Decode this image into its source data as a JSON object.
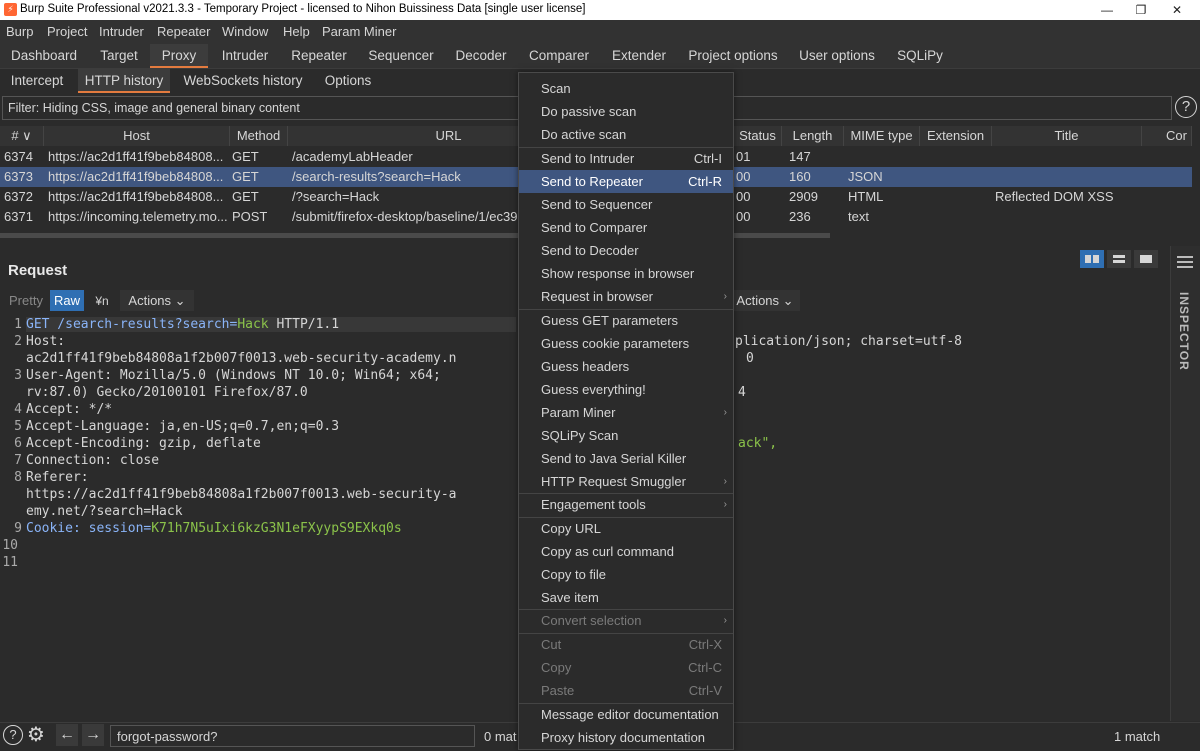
{
  "window": {
    "title": "Burp Suite Professional v2021.3.3 - Temporary Project - licensed to Nihon Buissiness Data [single user license]",
    "min": "—",
    "restore": "❐",
    "close": "✕"
  },
  "menubar": [
    "Burp",
    "Project",
    "Intruder",
    "Repeater",
    "Window",
    "Help",
    "Param Miner"
  ],
  "tool_tabs": [
    "Dashboard",
    "Target",
    "Proxy",
    "Intruder",
    "Repeater",
    "Sequencer",
    "Decoder",
    "Comparer",
    "Extender",
    "Project options",
    "User options",
    "SQLiPy"
  ],
  "active_tool_tab": "Proxy",
  "sub_tabs": [
    "Intercept",
    "HTTP history",
    "WebSockets history",
    "Options"
  ],
  "active_sub_tab": "HTTP history",
  "filter": "Filter: Hiding CSS, image and general binary content",
  "help": "?",
  "table": {
    "headers": [
      "# ∨",
      "Host",
      "Method",
      "URL",
      "Status",
      "Length",
      "MIME type",
      "Extension",
      "Title",
      "Cor"
    ],
    "rows": [
      {
        "id": "6374",
        "host": "https://ac2d1ff41f9beb84808...",
        "method": "GET",
        "url": "/academyLabHeader",
        "status": "01",
        "length": "147",
        "mime": "",
        "ext": "",
        "title": ""
      },
      {
        "id": "6373",
        "host": "https://ac2d1ff41f9beb84808...",
        "method": "GET",
        "url": "/search-results?search=Hack",
        "status": "00",
        "length": "160",
        "mime": "JSON",
        "ext": "",
        "title": ""
      },
      {
        "id": "6372",
        "host": "https://ac2d1ff41f9beb84808...",
        "method": "GET",
        "url": "/?search=Hack",
        "status": "00",
        "length": "2909",
        "mime": "HTML",
        "ext": "",
        "title": "Reflected DOM XSS"
      },
      {
        "id": "6371",
        "host": "https://incoming.telemetry.mo...",
        "method": "POST",
        "url": "/submit/firefox-desktop/baseline/1/ec39",
        "status": "00",
        "length": "236",
        "mime": "text",
        "ext": "",
        "title": ""
      }
    ],
    "selected_index": 1
  },
  "request": {
    "title": "Request",
    "tabs": [
      "Pretty",
      "Raw",
      "\\n",
      "Actions"
    ],
    "active_tab": "Raw",
    "lines": [
      {
        "n": "1",
        "text": "GET /search-results?search=Hack HTTP/1.1"
      },
      {
        "n": "2",
        "text": "Host:"
      },
      {
        "n": "",
        "text": "ac2d1ff41f9beb84808a1f2b007f0013.web-security-academy.n"
      },
      {
        "n": "3",
        "text": "User-Agent: Mozilla/5.0 (Windows NT 10.0; Win64; x64;"
      },
      {
        "n": "",
        "text": "rv:87.0) Gecko/20100101 Firefox/87.0"
      },
      {
        "n": "4",
        "text": "Accept: */*"
      },
      {
        "n": "5",
        "text": "Accept-Language: ja,en-US;q=0.7,en;q=0.3"
      },
      {
        "n": "6",
        "text": "Accept-Encoding: gzip, deflate"
      },
      {
        "n": "7",
        "text": "Connection: close"
      },
      {
        "n": "8",
        "text": "Referer:"
      },
      {
        "n": "",
        "text": "https://ac2d1ff41f9beb84808a1f2b007f0013.web-security-a"
      },
      {
        "n": "",
        "text": "emy.net/?search=Hack"
      },
      {
        "n": "9",
        "text": "Cookie: session=K71h7N5uIxi6kzG3N1eFXyypS9EXkq0s"
      },
      {
        "n": "10",
        "text": ""
      },
      {
        "n": "11",
        "text": ""
      }
    ]
  },
  "response": {
    "actions": "Actions",
    "line1": "plication/json; charset=utf-8",
    "line2": "0",
    "line3": "4",
    "line4": "ack\","
  },
  "inspector": "INSPECTOR",
  "bottom": {
    "search_value": "forgot-password?",
    "left_matches": "0 mat",
    "right_matches": "1 match"
  },
  "context_menu": [
    {
      "label": "Scan"
    },
    {
      "label": "Do passive scan"
    },
    {
      "label": "Do active scan"
    },
    {
      "sep": true
    },
    {
      "label": "Send to Intruder",
      "shortcut": "Ctrl-I"
    },
    {
      "label": "Send to Repeater",
      "shortcut": "Ctrl-R",
      "highlight": true
    },
    {
      "label": "Send to Sequencer"
    },
    {
      "label": "Send to Comparer"
    },
    {
      "label": "Send to Decoder"
    },
    {
      "label": "Show response in browser"
    },
    {
      "label": "Request in browser",
      "submenu": true
    },
    {
      "sep": true
    },
    {
      "label": "Guess GET parameters"
    },
    {
      "label": "Guess cookie parameters"
    },
    {
      "label": "Guess headers"
    },
    {
      "label": "Guess everything!"
    },
    {
      "label": "Param Miner",
      "submenu": true
    },
    {
      "label": "SQLiPy Scan"
    },
    {
      "label": "Send to Java Serial Killer"
    },
    {
      "label": "HTTP Request Smuggler",
      "submenu": true
    },
    {
      "sep": true
    },
    {
      "label": "Engagement tools",
      "submenu": true
    },
    {
      "sep": true
    },
    {
      "label": "Copy URL"
    },
    {
      "label": "Copy as curl command"
    },
    {
      "label": "Copy to file"
    },
    {
      "label": "Save item"
    },
    {
      "sep": true
    },
    {
      "label": "Convert selection",
      "submenu": true,
      "disabled": true
    },
    {
      "sep": true
    },
    {
      "label": "Cut",
      "shortcut": "Ctrl-X",
      "disabled": true
    },
    {
      "label": "Copy",
      "shortcut": "Ctrl-C",
      "disabled": true
    },
    {
      "label": "Paste",
      "shortcut": "Ctrl-V",
      "disabled": true
    },
    {
      "sep": true
    },
    {
      "label": "Message editor documentation"
    },
    {
      "label": "Proxy history documentation"
    }
  ],
  "colors": {
    "accent": "#e37b3f",
    "selection": "#3f5680",
    "raw_tab": "#2f6fb3"
  },
  "icons": [
    "burp-logo-icon",
    "help-icon",
    "settings-gear-icon",
    "back-arrow-icon",
    "forward-arrow-icon",
    "chevron-down-icon",
    "submenu-arrow-icon",
    "split-horizontal-icon",
    "split-vertical-icon",
    "single-pane-icon",
    "inspector-menu-icon"
  ]
}
